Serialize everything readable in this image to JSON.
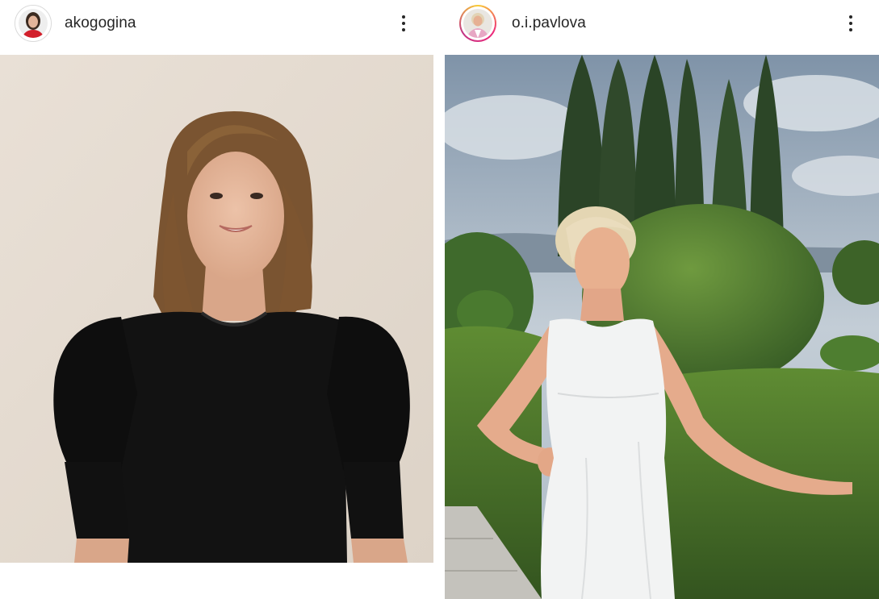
{
  "posts": [
    {
      "username": "akogogina",
      "avatar_style": "plain",
      "menu_icon": "more-vertical-icon",
      "photo_description_colors": {
        "background": "#e7ddd2",
        "dress": "#111111",
        "hair": "#8a6238",
        "skin": "#e2b49a"
      }
    },
    {
      "username": "o.i.pavlova",
      "avatar_style": "story-ring",
      "menu_icon": "more-vertical-icon",
      "photo_description_colors": {
        "sky": "#93a9bf",
        "trees": "#2f4a2a",
        "hedge": "#4f7a2f",
        "dress": "#f2f3f3",
        "hair": "#e5d7b6",
        "skin": "#e8b08f"
      }
    }
  ]
}
